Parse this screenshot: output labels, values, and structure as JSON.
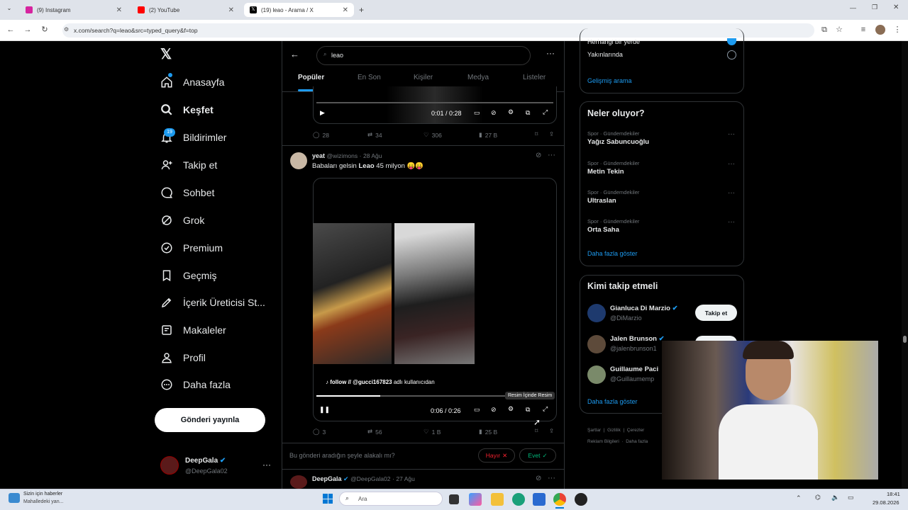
{
  "browser": {
    "tabs": [
      {
        "title": "(9) Instagram",
        "color": "#d6249f"
      },
      {
        "title": "(2) YouTube",
        "color": "#ff0000"
      },
      {
        "title": "(19) leao - Arama / X",
        "color": "#000000"
      }
    ],
    "url": "x.com/search?q=leao&src=typed_query&f=top"
  },
  "nav": {
    "items": [
      {
        "label": "Anasayfa",
        "icon": "home-icon"
      },
      {
        "label": "Keşfet",
        "icon": "search-icon"
      },
      {
        "label": "Bildirimler",
        "icon": "bell-icon",
        "badge": "19"
      },
      {
        "label": "Takip et",
        "icon": "person-plus-icon"
      },
      {
        "label": "Sohbet",
        "icon": "chat-icon"
      },
      {
        "label": "Grok",
        "icon": "grok-icon"
      },
      {
        "label": "Premium",
        "icon": "premium-icon"
      },
      {
        "label": "Geçmiş",
        "icon": "bookmark-icon"
      },
      {
        "label": "İçerik Üreticisi St...",
        "icon": "rocket-icon"
      },
      {
        "label": "Makaleler",
        "icon": "article-icon"
      },
      {
        "label": "Profil",
        "icon": "profile-icon"
      },
      {
        "label": "Daha fazla",
        "icon": "more-circle-icon"
      }
    ],
    "post_button": "Gönderi yayınla",
    "account": {
      "name": "DeepGala",
      "handle": "@DeepGala02"
    }
  },
  "search": {
    "query": "leao",
    "tabs": [
      "Popüler",
      "En Son",
      "Kişiler",
      "Medya",
      "Listeler"
    ]
  },
  "post1": {
    "time": "0:01 / 0:28",
    "replies": "28",
    "reposts": "34",
    "likes": "306",
    "views": "27 B"
  },
  "post2": {
    "name": "yeat",
    "handle": "@wizimons",
    "date": "28 Ağu",
    "text_before": "Babaları gelsin ",
    "text_bold": "Leao",
    "text_after": " 45 milyon 😛😛",
    "caption_bold": "follow // @gucci167823",
    "caption_rest": " adlı kullanıcıdan",
    "tooltip": "Resim İçinde Resim",
    "time": "0:06 / 0:26",
    "progress": 0.27,
    "replies": "3",
    "reposts": "56",
    "likes": "1 B",
    "views": "25 B"
  },
  "feedback": {
    "question": "Bu gönderi aradığın şeyle alakalı mı?",
    "no": "Hayır",
    "yes": "Evet"
  },
  "post3": {
    "name": "DeepGala",
    "handle": "@DeepGala02",
    "date": "27 Ağu"
  },
  "location_filter": {
    "option1": "Herhangi bir yerde",
    "option2": "Yakınlarında",
    "advanced": "Gelişmiş arama"
  },
  "trends": {
    "title": "Neler oluyor?",
    "items": [
      {
        "category": "Spor · Gündemdekiler",
        "name": "Yağız Sabuncuoğlu"
      },
      {
        "category": "Spor · Gündemdekiler",
        "name": "Metin Tekin"
      },
      {
        "category": "Spor · Gündemdekiler",
        "name": "Ultraslan"
      },
      {
        "category": "Spor · Gündemdekiler",
        "name": "Orta Saha"
      }
    ],
    "show_more": "Daha fazla göster"
  },
  "who_to_follow": {
    "title": "Kimi takip etmeli",
    "users": [
      {
        "name": "Gianluca Di Marzio",
        "handle": "@DiMarzio"
      },
      {
        "name": "Jalen Brunson",
        "handle": "@jalenbrunson1"
      },
      {
        "name": "Guillaume Paci",
        "handle": "@Guillaumemp"
      }
    ],
    "follow_label": "Takip et",
    "show_more": "Daha fazla göster"
  },
  "footer_links": [
    "Şartlar",
    "Gizlilik",
    "Çerezler",
    "Reklam Bilgileri",
    "Daha fazla"
  ],
  "taskbar": {
    "news_title": "Sizin için haberler",
    "news_sub": "Mahalledeki yan...",
    "search_placeholder": "Ara",
    "time": "18:41",
    "date": "29.08.2026"
  },
  "colors": {
    "accent": "#1d9bf0",
    "bg": "#000000",
    "text": "#e7e9ea",
    "muted": "#71767b"
  }
}
